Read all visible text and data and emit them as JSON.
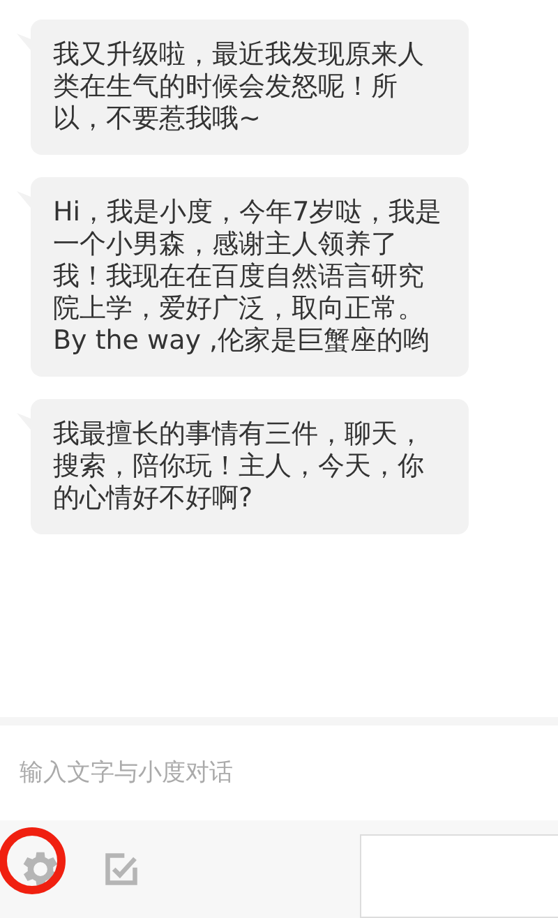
{
  "messages": [
    {
      "text": "我又升级啦，最近我发现原来人类在生气的时候会发怒呢！所以，不要惹我哦~"
    },
    {
      "text": "Hi，我是小度，今年7岁哒，我是一个小男森，感谢主人领养了我！我现在在百度自然语言研究院上学，爱好广泛，取向正常。By the way ,伦家是巨蟹座的哟"
    },
    {
      "text": "我最擅长的事情有三件，聊天，搜索，陪你玩！主人，今天，你的心情好不好啊?"
    }
  ],
  "input": {
    "placeholder": "输入文字与小度对话"
  },
  "toolbar": {
    "settings_highlighted": true
  }
}
